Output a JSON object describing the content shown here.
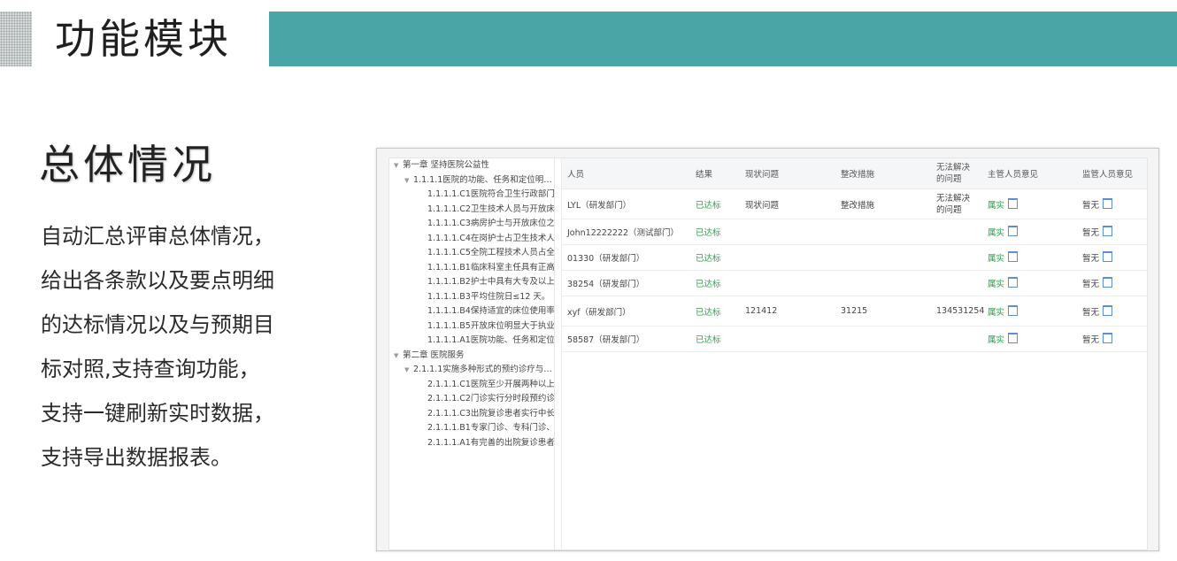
{
  "header": {
    "title": "功能模块"
  },
  "section": {
    "title": "总体情况",
    "description_lines": [
      "自动汇总评审总体情况，",
      "给出各条款以及要点明细",
      "的达标情况以及与预期目",
      "标对照,支持查询功能，",
      "支持一键刷新实时数据，",
      "支持导出数据报表。"
    ]
  },
  "tree": [
    {
      "level": 0,
      "label": "第一章 坚持医院公益性",
      "expanded": true
    },
    {
      "level": 1,
      "label": "1.1.1.1医院的功能、任务和定位明…",
      "expanded": true
    },
    {
      "level": 2,
      "label": "1.1.1.1.C1医院符合卫生行政部门"
    },
    {
      "level": 2,
      "label": "1.1.1.1.C2卫生技术人员与开放床"
    },
    {
      "level": 2,
      "label": "1.1.1.1.C3病房护士与开放床位之"
    },
    {
      "level": 2,
      "label": "1.1.1.1.C4在岗护士占卫生技术人"
    },
    {
      "level": 2,
      "label": "1.1.1.1.C5全院工程技术人员占全"
    },
    {
      "level": 2,
      "label": "1.1.1.1.B1临床科室主任具有正高"
    },
    {
      "level": 2,
      "label": "1.1.1.1.B2护士中具有大专及以上"
    },
    {
      "level": 2,
      "label": "1.1.1.1.B3平均住院日≤12 天。"
    },
    {
      "level": 2,
      "label": "1.1.1.1.B4保持适宜的床位使用率"
    },
    {
      "level": 2,
      "label": "1.1.1.1.B5开放床位明显大于执业"
    },
    {
      "level": 2,
      "label": "1.1.1.1.A1医院功能、任务和定位"
    },
    {
      "level": 0,
      "label": "第二章 医院服务",
      "expanded": true
    },
    {
      "level": 1,
      "label": "2.1.1.1实施多种形式的预约诊疗与…",
      "expanded": true
    },
    {
      "level": 2,
      "label": "2.1.1.1.C1医院至少开展两种以上"
    },
    {
      "level": 2,
      "label": "2.1.1.1.C2门诊实行分时段预约诊"
    },
    {
      "level": 2,
      "label": "2.1.1.1.C3出院复诊患者实行中长"
    },
    {
      "level": 2,
      "label": "2.1.1.1.B1专家门诊、专科门诊、"
    },
    {
      "level": 2,
      "label": "2.1.1.1.A1有完善的出院复诊患者"
    }
  ],
  "table": {
    "headers": [
      "人员",
      "结果",
      "现状问题",
      "整改措施",
      "无法解决的问题",
      "主管人员意见",
      "监管人员意见"
    ],
    "rows": [
      {
        "person": "LYL（研发部门）",
        "result": "已达标",
        "issue": "现状问题",
        "measure": "整改措施",
        "unsolved": "无法解决的问题",
        "manager": "属实",
        "supervisor": "暂无"
      },
      {
        "person": "John12222222（测试部门）",
        "result": "已达标",
        "issue": "",
        "measure": "",
        "unsolved": "",
        "manager": "属实",
        "supervisor": "暂无"
      },
      {
        "person": "01330（研发部门）",
        "result": "已达标",
        "issue": "",
        "measure": "",
        "unsolved": "",
        "manager": "属实",
        "supervisor": "暂无"
      },
      {
        "person": "38254（研发部门）",
        "result": "已达标",
        "issue": "",
        "measure": "",
        "unsolved": "",
        "manager": "属实",
        "supervisor": "暂无"
      },
      {
        "person": "xyf（研发部门）",
        "result": "已达标",
        "issue": "121412",
        "measure": "31215",
        "unsolved": "134531254",
        "manager": "属实",
        "supervisor": "暂无"
      },
      {
        "person": "58587（研发部门）",
        "result": "已达标",
        "issue": "",
        "measure": "",
        "unsolved": "",
        "manager": "属实",
        "supervisor": "暂无"
      }
    ]
  },
  "colors": {
    "header_bar": "#4aa5a7",
    "status_ok": "#2aa34a"
  }
}
